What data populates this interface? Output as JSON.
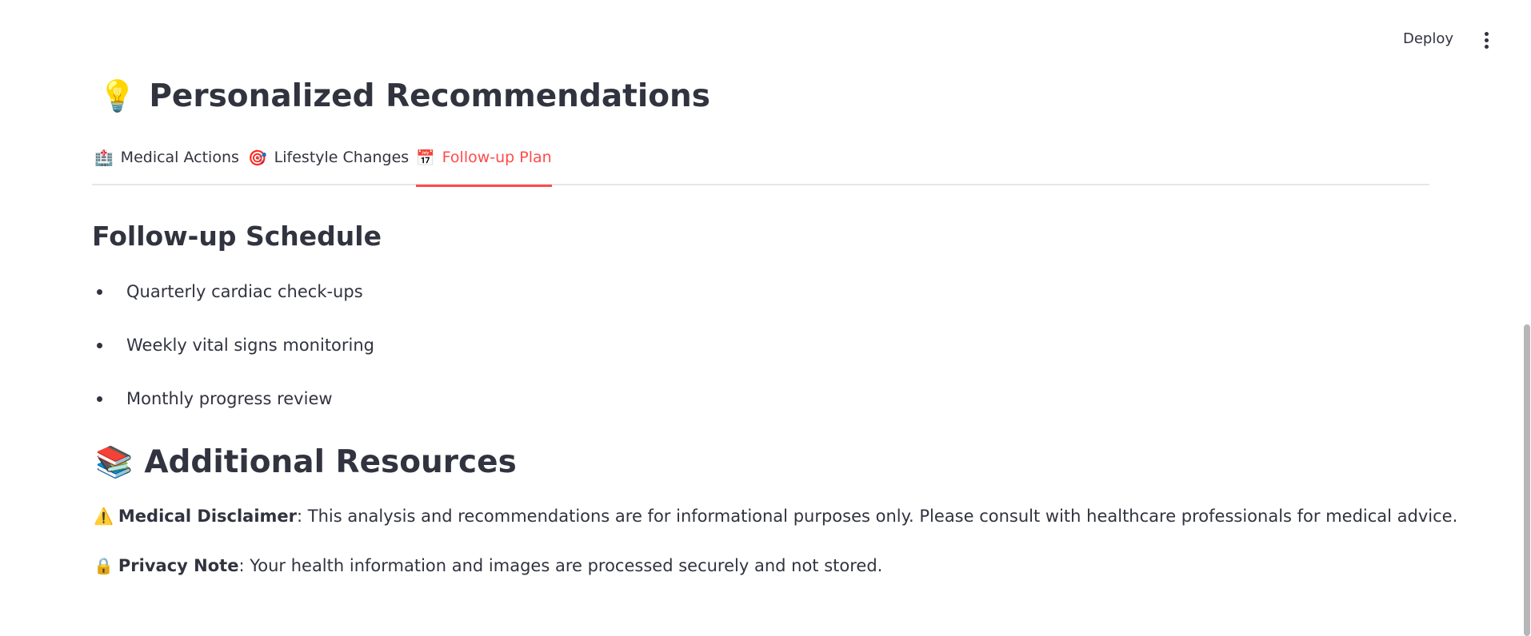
{
  "header": {
    "deploy_label": "Deploy",
    "menu_icon": "vertical-ellipsis-icon"
  },
  "page": {
    "title_emoji": "💡",
    "title": "Personalized Recommendations"
  },
  "tabs": [
    {
      "icon": "🏥",
      "label": "Medical Actions",
      "active": false
    },
    {
      "icon": "🎯",
      "label": "Lifestyle Changes",
      "active": false
    },
    {
      "icon": "📅",
      "label": "Follow-up Plan",
      "active": true
    }
  ],
  "followup": {
    "heading": "Follow-up Schedule",
    "items": [
      "Quarterly cardiac check-ups",
      "Weekly vital signs monitoring",
      "Monthly progress review"
    ]
  },
  "resources": {
    "emoji": "📚",
    "heading": "Additional Resources",
    "disclaimer": {
      "emoji": "⚠️",
      "label": "Medical Disclaimer",
      "text": ": This analysis and recommendations are for informational purposes only. Please consult with healthcare professionals for medical advice."
    },
    "privacy": {
      "emoji": "🔒",
      "label": "Privacy Note",
      "text": ": Your health information and images are processed securely and not stored."
    }
  },
  "colors": {
    "accent": "#ff4b4b",
    "text": "#31333f",
    "divider": "#e6e6ea"
  }
}
